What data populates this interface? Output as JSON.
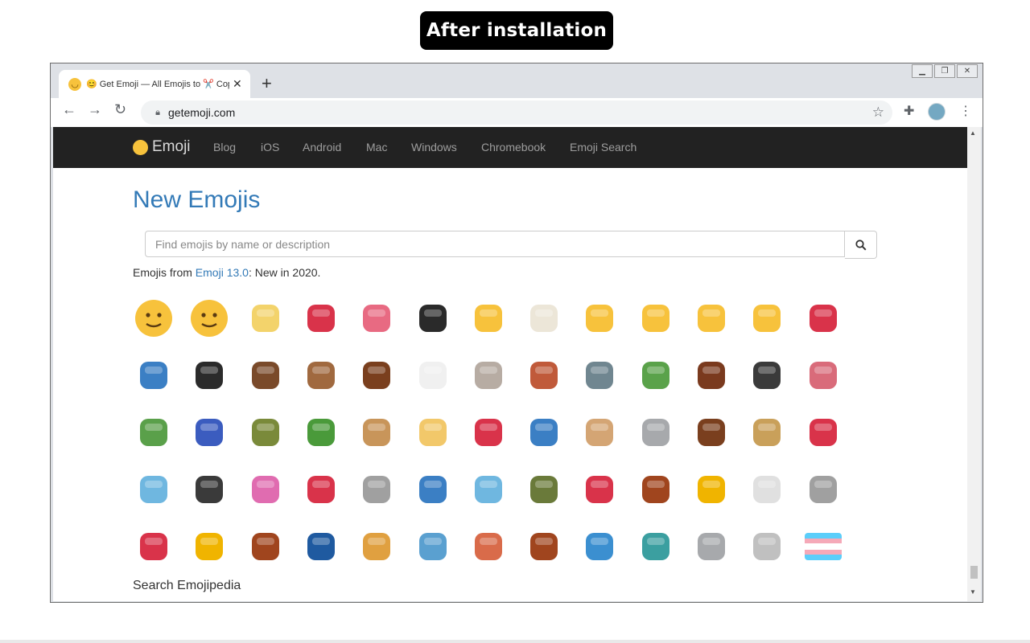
{
  "banner": {
    "text": "After installation"
  },
  "browser": {
    "tab_title": "😊 Get Emoji — All Emojis to ✂️ Copy and Paste",
    "tab_favicon": "smile-emoji",
    "url": "getemoji.com",
    "window_controls": [
      "minimize",
      "restore",
      "close"
    ]
  },
  "site": {
    "brand": "Emoji",
    "nav": [
      "Blog",
      "iOS",
      "Android",
      "Mac",
      "Windows",
      "Chromebook",
      "Emoji Search"
    ],
    "page_title": "New Emojis",
    "search_placeholder": "Find emojis by name or description",
    "intro_prefix": "Emojis from ",
    "intro_link": "Emoji 13.0",
    "intro_suffix": ": New in 2020.",
    "footer_heading": "Search Emojipedia"
  },
  "emoji_rows": [
    [
      "🥲",
      "🥸",
      "🤌",
      "🫀",
      "🫁",
      "🥷",
      "🤵‍♂️",
      "👰‍♂️",
      "👰‍♀️",
      "👩‍🍼",
      "🧑‍🍼",
      "👨‍🍼",
      "🧑‍🎄"
    ],
    [
      "🫂",
      "🐈‍⬛",
      "🦬",
      "🦣",
      "🦫",
      "🐻‍❄️",
      "🦤",
      "🪶",
      "🦭",
      "🪲",
      "🪳",
      "🪰",
      "🪱"
    ],
    [
      "🪴",
      "🫐",
      "🫒",
      "🫑",
      "🫓",
      "🫔",
      "🫕",
      "🫖",
      "🧋",
      "🪨",
      "🪵",
      "🛖",
      "🛻"
    ],
    [
      "🛼",
      "🪄",
      "🪅",
      "🪆",
      "🪡",
      "🪢",
      "🩴",
      "🪖",
      "🪗",
      "🪘",
      "🪙",
      "🪃",
      "🪚"
    ],
    [
      "🪛",
      "🪝",
      "🪜",
      "🛗",
      "🪞",
      "🪟",
      "🪠",
      "🪤",
      "🪣",
      "🪥",
      "🪦",
      "🪧",
      "🏳️‍⚧️"
    ]
  ],
  "icons": {
    "back": "arrow-left-icon",
    "forward": "arrow-right-icon",
    "reload": "reload-icon",
    "lock": "lock-icon",
    "star": "star-icon",
    "extensions": "puzzle-icon",
    "menu": "kebab-menu-icon",
    "search": "search-icon"
  },
  "colors": {
    "link": "#337ab7",
    "navbar": "#222222",
    "banner": "#000000"
  }
}
